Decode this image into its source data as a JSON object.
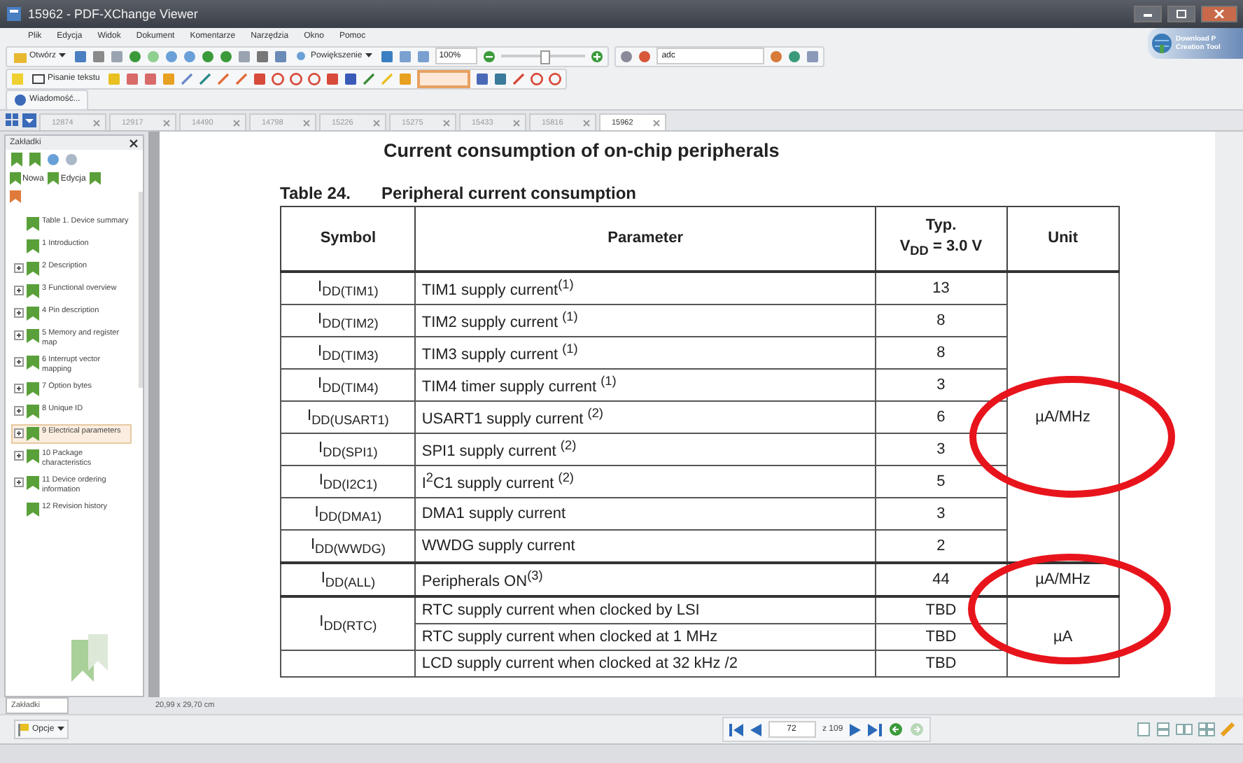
{
  "window": {
    "title": "15962 - PDF-XChange Viewer"
  },
  "promo": [
    "Download P",
    "Creation Tool"
  ],
  "menu": [
    "Plik",
    "Edycja",
    "Widok",
    "Dokument",
    "Komentarze",
    "Narzędzia",
    "Okno",
    "Pomoc"
  ],
  "toolbar": {
    "open_label": "Otwórz",
    "zoom_label": "Powiększenie",
    "zoom_value": "100%",
    "zoom_slider": {
      "level": 0.5
    },
    "search_value": "adc",
    "typewriter_label": "Pisanie tekstu",
    "message_label": "Wiadomość..."
  },
  "tabs": [
    {
      "label": "12874",
      "selected": false
    },
    {
      "label": "12917",
      "selected": false
    },
    {
      "label": "14490",
      "selected": false
    },
    {
      "label": "14798",
      "selected": false
    },
    {
      "label": "15226",
      "selected": false
    },
    {
      "label": "15275",
      "selected": false
    },
    {
      "label": "15433",
      "selected": false
    },
    {
      "label": "15816",
      "selected": false
    },
    {
      "label": "15962",
      "selected": true
    }
  ],
  "sidebar": {
    "title": "Zakładki",
    "new_label": "Nowa",
    "edit_label": "Edycja",
    "tab_label": "Zakładki",
    "items": [
      {
        "label": "Table 1. Device summary",
        "expandable": false,
        "selected": false
      },
      {
        "label": "1 Introduction",
        "expandable": false,
        "selected": false
      },
      {
        "label": "2 Description",
        "expandable": true,
        "selected": false
      },
      {
        "label": "3 Functional overview",
        "expandable": true,
        "selected": false
      },
      {
        "label": "4 Pin description",
        "expandable": true,
        "selected": false
      },
      {
        "label": "5 Memory and register map",
        "expandable": true,
        "selected": false
      },
      {
        "label": "6 Interrupt vector mapping",
        "expandable": true,
        "selected": false
      },
      {
        "label": "7 Option bytes",
        "expandable": true,
        "selected": false
      },
      {
        "label": "8 Unique ID",
        "expandable": true,
        "selected": false
      },
      {
        "label": "9 Electrical parameters",
        "expandable": true,
        "selected": true
      },
      {
        "label": "10 Package characteristics",
        "expandable": true,
        "selected": false
      },
      {
        "label": "11 Device ordering information",
        "expandable": true,
        "selected": false
      },
      {
        "label": "12 Revision history",
        "expandable": false,
        "selected": false
      }
    ]
  },
  "document": {
    "heading": "Current consumption of on-chip peripherals",
    "table_number": "Table 24.",
    "table_title": "Peripheral current consumption",
    "columns": [
      "Symbol",
      "Parameter",
      "Typ.\nV$_{DD}$ = 3.0 V",
      "Unit"
    ],
    "groups": [
      {
        "unit": "µA/MHz",
        "rows": [
          {
            "symbol": "I$_{DD(TIM1)}$",
            "lines": [
              {
                "parameter": "TIM1 supply current$^{(1)}$",
                "typ": "13"
              }
            ]
          },
          {
            "symbol": "I$_{DD(TIM2)}$",
            "lines": [
              {
                "parameter": "TIM2 supply current $^{(1)}$",
                "typ": "8"
              }
            ]
          },
          {
            "symbol": "I$_{DD(TIM3)}$",
            "lines": [
              {
                "parameter": "TIM3 supply current $^{(1)}$",
                "typ": "8"
              }
            ]
          },
          {
            "symbol": "I$_{DD(TIM4)}$",
            "lines": [
              {
                "parameter": "TIM4 timer supply current $^{(1)}$",
                "typ": "3"
              }
            ]
          },
          {
            "symbol": "I$_{DD(USART1)}$",
            "lines": [
              {
                "parameter": "USART1 supply current $^{(2)}$",
                "typ": "6"
              }
            ]
          },
          {
            "symbol": "I$_{DD(SPI1)}$",
            "lines": [
              {
                "parameter": "SPI1 supply current $^{(2)}$",
                "typ": "3"
              }
            ]
          },
          {
            "symbol": "I$_{DD(I2C1)}$",
            "lines": [
              {
                "parameter": "I$^{2}$C1 supply current $^{(2)}$",
                "typ": "5"
              }
            ]
          },
          {
            "symbol": "I$_{DD(DMA1)}$",
            "lines": [
              {
                "parameter": "DMA1 supply current",
                "typ": "3"
              }
            ]
          },
          {
            "symbol": "I$_{DD(WWDG)}$",
            "lines": [
              {
                "parameter": "WWDG supply current",
                "typ": "2"
              }
            ]
          }
        ]
      },
      {
        "unit": "µA/MHz",
        "rows": [
          {
            "symbol": "I$_{DD(ALL)}$",
            "lines": [
              {
                "parameter": "Peripherals ON$^{(3)}$",
                "typ": "44"
              }
            ]
          }
        ]
      },
      {
        "unit": "µA",
        "rows": [
          {
            "symbol": "I$_{DD(RTC)}$",
            "lines": [
              {
                "parameter": "RTC supply current when clocked by LSI",
                "typ": "TBD"
              },
              {
                "parameter": "RTC supply current when clocked at 1 MHz",
                "typ": "TBD"
              }
            ]
          },
          {
            "lines": [
              {
                "parameter": "LCD supply current when clocked at 32 kHz /2",
                "typ": "TBD"
              }
            ]
          }
        ]
      }
    ]
  },
  "status": {
    "page_size": "20,99 x 29,70 cm"
  },
  "bottom": {
    "options_label": "Opcje",
    "page_value": "72",
    "page_total": "z 109"
  }
}
